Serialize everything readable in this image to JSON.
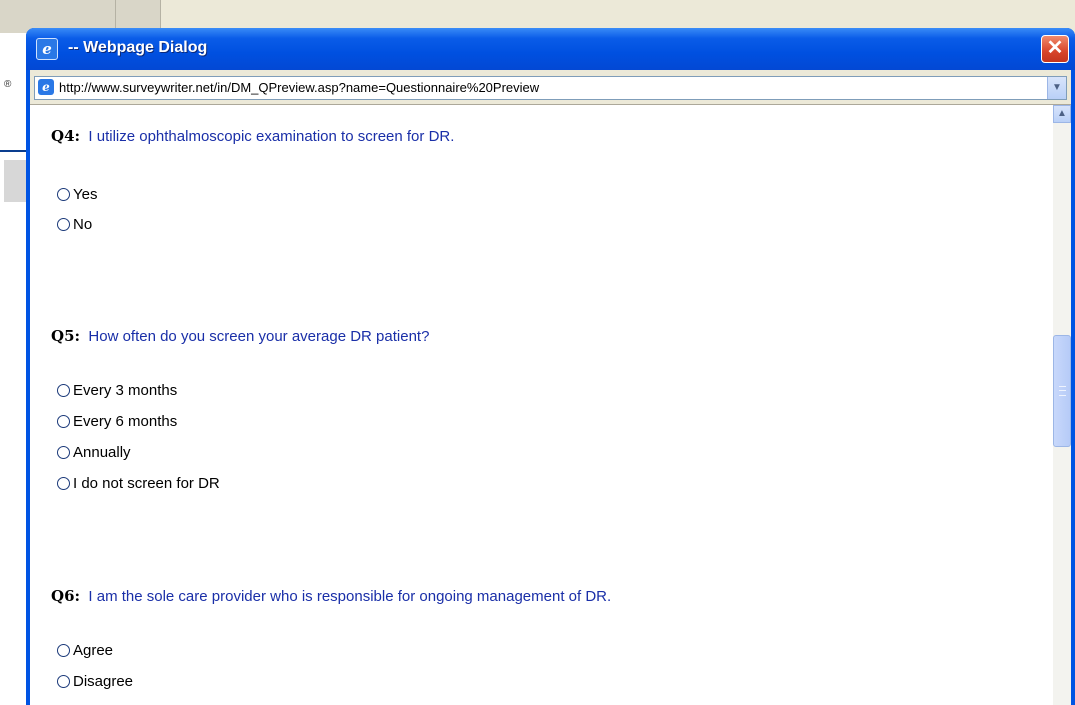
{
  "background": {
    "reg_mark": "®"
  },
  "dialog": {
    "title": "-- Webpage Dialog",
    "close_label": "✕",
    "address": "http://www.surveywriter.net/in/DM_QPreview.asp?name=Questionnaire%20Preview",
    "icons": {
      "title": "ie-icon",
      "address": "ie-page-icon",
      "dropdown": "chevron-down-icon",
      "scroll_up": "chevron-up-icon"
    }
  },
  "questions": [
    {
      "num": "Q4:",
      "text": "I utilize ophthalmoscopic examination to screen for DR.",
      "options": [
        "Yes",
        "No"
      ]
    },
    {
      "num": "Q5:",
      "text": "How often do you screen your average DR patient?",
      "options": [
        "Every 3 months",
        "Every 6 months",
        "Annually",
        "I do not screen for DR"
      ]
    },
    {
      "num": "Q6:",
      "text": "I am the sole care provider who is responsible for ongoing management of DR.",
      "options": [
        "Agree",
        "Disagree"
      ]
    }
  ],
  "colors": {
    "question_text": "#1a2fa8",
    "title_bar": "#0054e3",
    "close_button": "#d8452a"
  }
}
